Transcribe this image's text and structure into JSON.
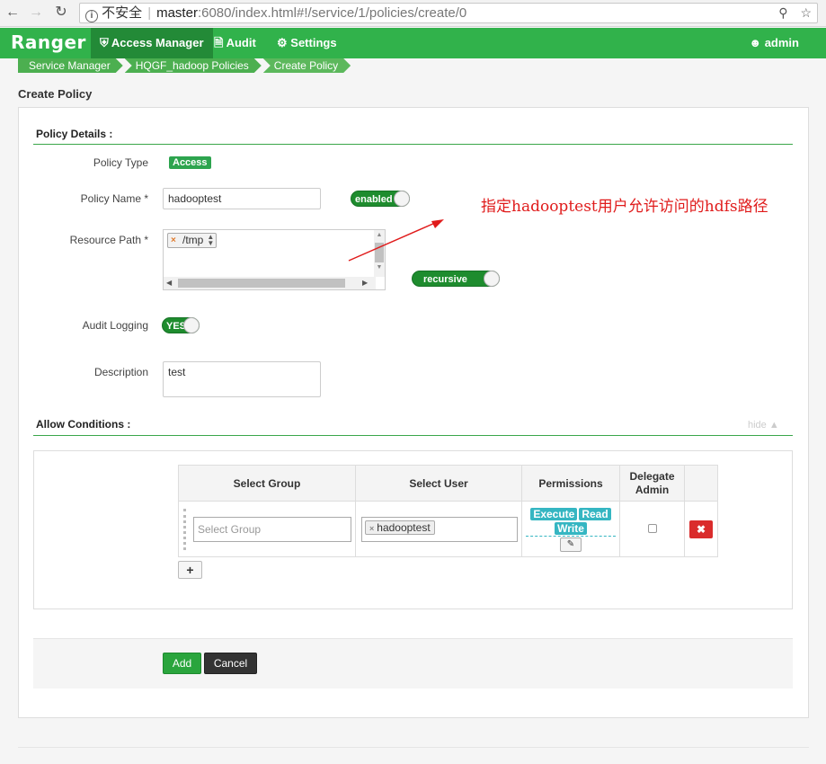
{
  "browser": {
    "back_icon": "arrow-left-icon",
    "forward_icon": "arrow-right-icon",
    "reload_icon": "reload-icon",
    "security_label": "不安全",
    "url_host": "master",
    "url_path": ":6080/index.html#!/service/1/policies/create/0"
  },
  "navbar": {
    "brand": "Ranger",
    "items": [
      {
        "label": "Access Manager",
        "icon": "shield-icon"
      },
      {
        "label": "Audit",
        "icon": "file-icon"
      },
      {
        "label": "Settings",
        "icon": "gear-icon"
      }
    ],
    "user": "admin"
  },
  "breadcrumb": [
    "Service Manager",
    "HQGF_hadoop Policies",
    "Create Policy"
  ],
  "page_title": "Create Policy",
  "policy_details": {
    "title": "Policy Details :",
    "policy_type_label": "Policy Type",
    "policy_type_value": "Access",
    "policy_name_label": "Policy Name *",
    "policy_name_value": "hadooptest",
    "enabled_toggle": "enabled",
    "resource_path_label": "Resource Path *",
    "resource_path_value": "/tmp",
    "recursive_toggle": "recursive",
    "audit_logging_label": "Audit Logging",
    "audit_logging_value": "YES",
    "description_label": "Description",
    "description_value": "test"
  },
  "annotation": "指定hadooptest用户允许访问的hdfs路径",
  "allow_conditions": {
    "title": "Allow Conditions :",
    "hide_label": "hide",
    "headers": [
      "Select Group",
      "Select User",
      "Permissions",
      "Delegate Admin"
    ],
    "row": {
      "group_placeholder": "Select Group",
      "user": "hadooptest",
      "permissions": [
        "Execute",
        "Read",
        "Write"
      ]
    }
  },
  "buttons": {
    "add": "Add",
    "cancel": "Cancel"
  },
  "colors": {
    "brand_green": "#31b24b",
    "annotation_red": "#e01b1b",
    "permission_tag": "#35b6c2",
    "delete_red": "#da2c2c"
  }
}
